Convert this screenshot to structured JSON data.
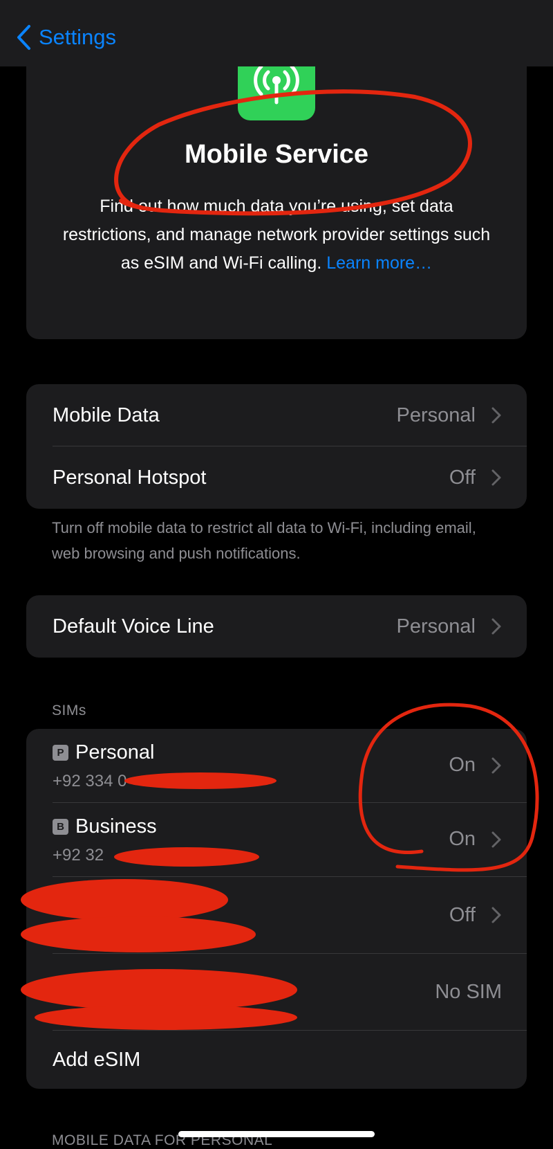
{
  "nav": {
    "back_label": "Settings"
  },
  "hero": {
    "title": "Mobile Service",
    "description": "Find out how much data you’re using, set data restrictions, and manage network provider settings such as eSIM and Wi-Fi calling.",
    "learn_more": "Learn more…"
  },
  "data_section": {
    "rows": [
      {
        "label": "Mobile Data",
        "value": "Personal"
      },
      {
        "label": "Personal Hotspot",
        "value": "Off"
      }
    ],
    "footer": "Turn off mobile data to restrict all data to Wi-Fi, including email, web browsing and push notifications."
  },
  "voice_section": {
    "rows": [
      {
        "label": "Default Voice Line",
        "value": "Personal"
      }
    ]
  },
  "sims_section": {
    "header": "SIMs",
    "sims": [
      {
        "badge": "P",
        "name": "Personal",
        "number": "+92 334 0",
        "status": "On"
      },
      {
        "badge": "B",
        "name": "Business",
        "number": "+92 32",
        "status": "On"
      }
    ],
    "other_rows": [
      {
        "value": "Off"
      },
      {
        "value": "No SIM"
      }
    ],
    "add_esim": "Add eSIM"
  },
  "next_section": {
    "header": "MOBILE DATA FOR PERSONAL"
  },
  "colors": {
    "accent": "#0a84ff",
    "green": "#30d158",
    "annotation": "#e3260f"
  }
}
